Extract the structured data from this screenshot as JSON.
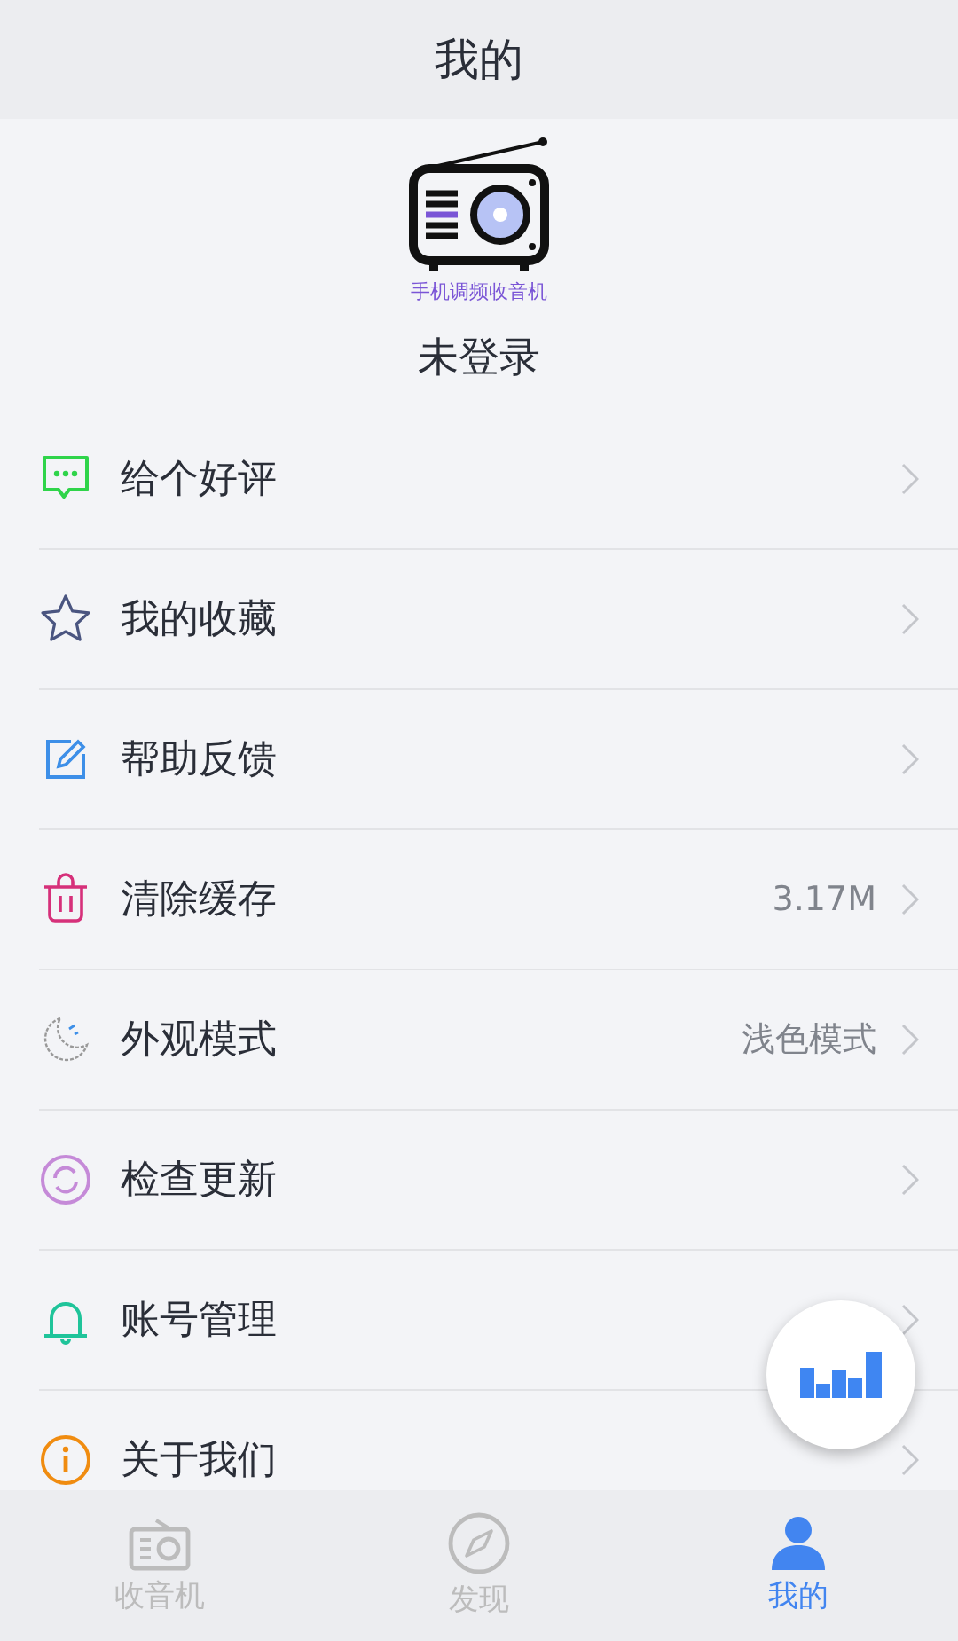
{
  "header": {
    "title": "我的"
  },
  "profile": {
    "app_caption": "手机调频收音机",
    "status": "未登录"
  },
  "menu": [
    {
      "label": "给个好评"
    },
    {
      "label": "我的收藏"
    },
    {
      "label": "帮助反馈"
    },
    {
      "label": "清除缓存",
      "value": "3.17M"
    },
    {
      "label": "外观模式",
      "value": "浅色模式"
    },
    {
      "label": "检查更新"
    },
    {
      "label": "账号管理"
    },
    {
      "label": "关于我们"
    }
  ],
  "tabs": [
    {
      "label": "收音机",
      "selected": false
    },
    {
      "label": "发现",
      "selected": false
    },
    {
      "label": "我的",
      "selected": true
    }
  ]
}
